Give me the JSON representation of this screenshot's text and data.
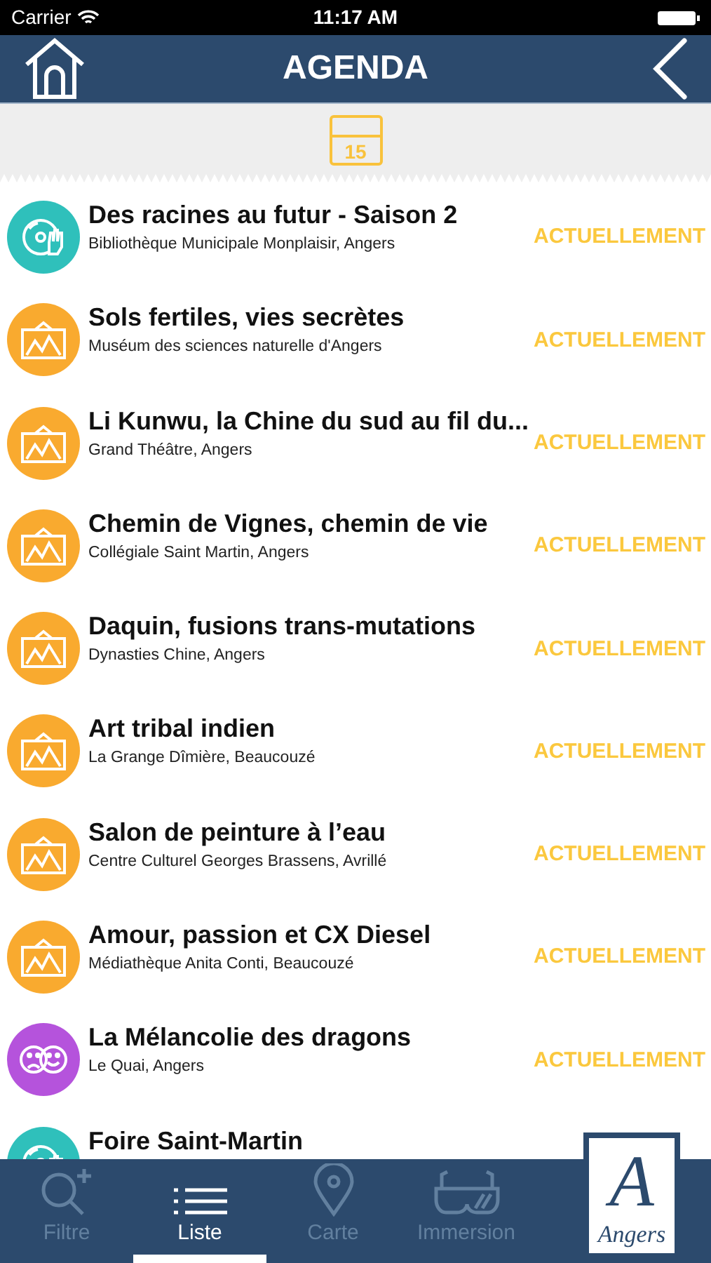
{
  "status_bar": {
    "carrier": "Carrier",
    "time": "11:17 AM"
  },
  "nav": {
    "title": "AGENDA"
  },
  "date_icon": {
    "day": "15"
  },
  "events": [
    {
      "kind": "music",
      "title": "Des racines au futur - Saison 2",
      "place": "Bibliothèque Municipale Monplaisir, Angers",
      "status": "ACTUELLEMENT"
    },
    {
      "kind": "exhibition",
      "title": "Sols fertiles, vies secrètes",
      "place": "Muséum des sciences naturelle d'Angers",
      "status": "ACTUELLEMENT"
    },
    {
      "kind": "exhibition",
      "title": "Li Kunwu, la Chine du sud au fil du...",
      "place": "Grand Théâtre, Angers",
      "status": "ACTUELLEMENT"
    },
    {
      "kind": "exhibition",
      "title": "Chemin de Vignes, chemin de vie",
      "place": "Collégiale Saint Martin, Angers",
      "status": "ACTUELLEMENT"
    },
    {
      "kind": "exhibition",
      "title": "Daquin, fusions trans-mutations",
      "place": "Dynasties Chine, Angers",
      "status": "ACTUELLEMENT"
    },
    {
      "kind": "exhibition",
      "title": "Art tribal indien",
      "place": "La Grange Dîmière, Beaucouzé",
      "status": "ACTUELLEMENT"
    },
    {
      "kind": "exhibition",
      "title": "Salon de peinture à l’eau",
      "place": "Centre Culturel Georges Brassens, Avrillé",
      "status": "ACTUELLEMENT"
    },
    {
      "kind": "exhibition",
      "title": "Amour, passion et CX Diesel",
      "place": "Médiathèque Anita Conti, Beaucouzé",
      "status": "ACTUELLEMENT"
    },
    {
      "kind": "theatre",
      "title": "La Mélancolie des dragons",
      "place": "Le Quai, Angers",
      "status": "ACTUELLEMENT"
    },
    {
      "kind": "music",
      "title": "Foire Saint-Martin"
    }
  ],
  "tabs": [
    {
      "kind": "filter",
      "label": "Filtre",
      "selected": false
    },
    {
      "kind": "list",
      "label": "Liste",
      "selected": true
    },
    {
      "kind": "map",
      "label": "Carte",
      "selected": false
    },
    {
      "kind": "glasses",
      "label": "Immersion",
      "selected": false
    }
  ],
  "logo": {
    "letter": "A",
    "name": "Angers"
  }
}
